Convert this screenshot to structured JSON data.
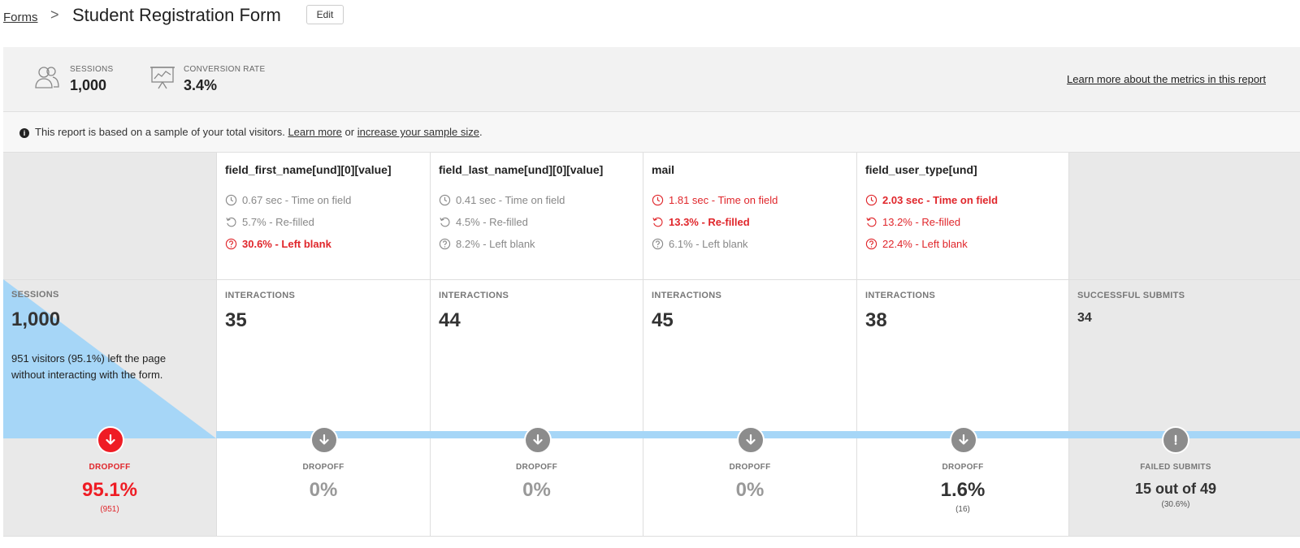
{
  "breadcrumb": {
    "parent": "Forms",
    "separator": ">",
    "title": "Student Registration Form",
    "edit_label": "Edit"
  },
  "metrics": {
    "sessions_label": "SESSIONS",
    "sessions_value": "1,000",
    "conversion_label": "CONVERSION RATE",
    "conversion_value": "3.4%",
    "learn_more": "Learn more about the metrics in this report"
  },
  "notice": {
    "icon": "info-icon",
    "text": "This report is based on a sample of your total visitors.",
    "learn_more": "Learn more",
    "or": "or",
    "increase": "increase your sample size",
    "period": "."
  },
  "fields": [
    {
      "name": "field_first_name[und][0][value]",
      "time": "0.67 sec - Time on field",
      "refilled": "5.7% - Re-filled",
      "blank": "30.6% - Left blank",
      "interactions_label": "INTERACTIONS",
      "interactions": "35",
      "dropoff_label": "DROPOFF",
      "dropoff": "0%",
      "dropoff_sub": ""
    },
    {
      "name": "field_last_name[und][0][value]",
      "time": "0.41 sec - Time on field",
      "refilled": "4.5% - Re-filled",
      "blank": "8.2% - Left blank",
      "interactions_label": "INTERACTIONS",
      "interactions": "44",
      "dropoff_label": "DROPOFF",
      "dropoff": "0%",
      "dropoff_sub": ""
    },
    {
      "name": "mail",
      "time": "1.81 sec - Time on field",
      "refilled": "13.3% - Re-filled",
      "blank": "6.1% - Left blank",
      "interactions_label": "INTERACTIONS",
      "interactions": "45",
      "dropoff_label": "DROPOFF",
      "dropoff": "0%",
      "dropoff_sub": ""
    },
    {
      "name": "field_user_type[und]",
      "time": "2.03 sec - Time on field",
      "refilled": "13.2% - Re-filled",
      "blank": "22.4% - Left blank",
      "interactions_label": "INTERACTIONS",
      "interactions": "38",
      "dropoff_label": "DROPOFF",
      "dropoff": "1.6%",
      "dropoff_sub": "(16)"
    }
  ],
  "sessions_col": {
    "label": "SESSIONS",
    "value": "1,000",
    "description": "951 visitors (95.1%) left the page without interacting with the form.",
    "dropoff_label": "DROPOFF",
    "dropoff": "95.1%",
    "dropoff_sub": "(951)"
  },
  "submit_col": {
    "label": "SUCCESSFUL SUBMITS",
    "value": "34",
    "failed_label": "FAILED SUBMITS",
    "failed": "15 out of 49",
    "failed_sub": "(30.6%)"
  },
  "colors": {
    "red": "#e0262b",
    "blue": "#a6d6f7",
    "grey_panel": "#e9e9e9"
  }
}
